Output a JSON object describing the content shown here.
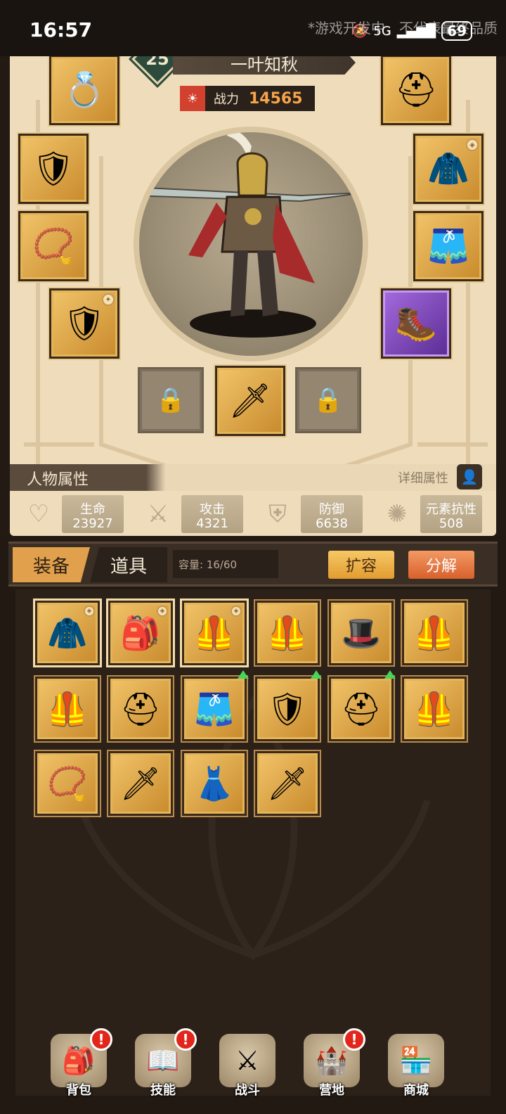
{
  "status_bar": {
    "time": "16:57",
    "watermark": "*游戏开发中，不代表最终品质",
    "network": "5G",
    "battery": "69"
  },
  "character": {
    "level": "25",
    "name": "一叶知秋",
    "power_label": "战力",
    "power_value": "14565"
  },
  "equip_slots": {
    "left": [
      {
        "icon": "ring-icon",
        "glyph": "💍"
      },
      {
        "icon": "bracer-icon",
        "glyph": "🛡"
      },
      {
        "icon": "necklace-icon",
        "glyph": "📿"
      },
      {
        "icon": "shield-icon",
        "glyph": "🛡"
      }
    ],
    "right": [
      {
        "icon": "helmet-icon",
        "glyph": "⛑"
      },
      {
        "icon": "armor-icon",
        "glyph": "🧥"
      },
      {
        "icon": "pants-icon",
        "glyph": "🩳"
      },
      {
        "icon": "boots-icon",
        "glyph": "🥾"
      }
    ],
    "weapons": [
      {
        "icon": "lock-icon",
        "glyph": "🔒"
      },
      {
        "icon": "sword-icon",
        "glyph": "🗡"
      },
      {
        "icon": "lock-icon",
        "glyph": "🔒"
      }
    ]
  },
  "attributes": {
    "title": "人物属性",
    "detail_label": "详细属性",
    "stats": [
      {
        "label": "生命",
        "value": "23927",
        "icon": "heart-icon",
        "glyph": "♡"
      },
      {
        "label": "攻击",
        "value": "4321",
        "icon": "attack-icon",
        "glyph": "⚔"
      },
      {
        "label": "防御",
        "value": "6638",
        "icon": "defense-icon",
        "glyph": "⛨"
      },
      {
        "label": "元素抗性",
        "value": "508",
        "icon": "element-icon",
        "glyph": "✺"
      }
    ]
  },
  "inventory": {
    "tabs": [
      "装备",
      "道具"
    ],
    "capacity": "容量: 16/60",
    "expand_label": "扩容",
    "decompose_label": "分解",
    "items": [
      {
        "icon": "blue-cloak-icon",
        "glyph": "🧥",
        "equipped": true,
        "upgrade": false
      },
      {
        "icon": "leather-belt-icon",
        "glyph": "🎒",
        "equipped": true,
        "upgrade": false
      },
      {
        "icon": "silver-armor-icon",
        "glyph": "🦺",
        "equipped": true,
        "upgrade": false
      },
      {
        "icon": "red-armor-icon",
        "glyph": "🦺",
        "equipped": false,
        "upgrade": false
      },
      {
        "icon": "green-hat-icon",
        "glyph": "🎩",
        "equipped": false,
        "upgrade": false
      },
      {
        "icon": "dark-armor-icon",
        "glyph": "🦺",
        "equipped": false,
        "upgrade": false
      },
      {
        "icon": "blue-plate-armor-icon",
        "glyph": "🦺",
        "equipped": false,
        "upgrade": false
      },
      {
        "icon": "golden-helmet-icon",
        "glyph": "⛑",
        "equipped": false,
        "upgrade": false
      },
      {
        "icon": "blue-shorts-icon",
        "glyph": "🩳",
        "equipped": false,
        "upgrade": true
      },
      {
        "icon": "round-shield-icon",
        "glyph": "🛡",
        "equipped": false,
        "upgrade": true
      },
      {
        "icon": "dark-helmet-icon",
        "glyph": "⛑",
        "equipped": false,
        "upgrade": true
      },
      {
        "icon": "golden-armor-icon",
        "glyph": "🦺",
        "equipped": false,
        "upgrade": false
      },
      {
        "icon": "purple-amulet-icon",
        "glyph": "📿",
        "equipped": false,
        "upgrade": false
      },
      {
        "icon": "purple-dagger-icon",
        "glyph": "🗡",
        "equipped": false,
        "upgrade": false
      },
      {
        "icon": "purple-skirt-icon",
        "glyph": "👗",
        "equipped": false,
        "upgrade": false
      },
      {
        "icon": "ice-sword-icon",
        "glyph": "🗡",
        "equipped": false,
        "upgrade": false
      }
    ]
  },
  "nav": [
    {
      "label": "背包",
      "icon": "backpack-icon",
      "glyph": "🎒",
      "badge": "!"
    },
    {
      "label": "技能",
      "icon": "skill-book-icon",
      "glyph": "📖",
      "badge": "!"
    },
    {
      "label": "战斗",
      "icon": "battle-icon",
      "glyph": "⚔",
      "badge": ""
    },
    {
      "label": "营地",
      "icon": "camp-icon",
      "glyph": "🏰",
      "badge": "!"
    },
    {
      "label": "商城",
      "icon": "shop-icon",
      "glyph": "🏪",
      "badge": ""
    }
  ],
  "colors": {
    "panel": "#efdcbb",
    "dark_bg": "#211912",
    "gold": "#e1a04c",
    "accent_orange": "#d9602c",
    "level_green": "#2c4b3c"
  }
}
